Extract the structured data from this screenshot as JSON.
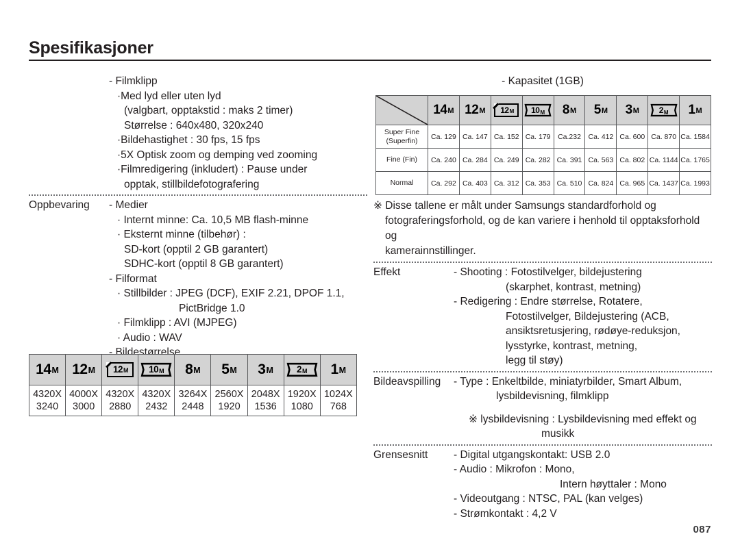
{
  "page": {
    "title": "Spesifikasjoner",
    "number": "087"
  },
  "left_column": {
    "block_movie": {
      "lines": [
        "- Filmklipp",
        "·Med lyd eller uten lyd",
        "(valgbart, opptakstid : maks 2 timer)",
        "Størrelse : 640x480, 320x240",
        "·Bildehastighet : 30 fps, 15 fps",
        "·5X Optisk zoom og demping ved zooming",
        "·Filmredigering (inkludert) : Pause under",
        "opptak, stillbildefotografering"
      ]
    },
    "block_storage": {
      "label": "Oppbevaring",
      "lines": [
        "- Medier",
        "· Internt minne: Ca. 10,5 MB flash-minne",
        "· Eksternt minne (tilbehør) :",
        "SD-kort (opptil 2 GB garantert)",
        "SDHC-kort (opptil 8 GB garantert)",
        "- Filformat",
        "· Stillbilder : JPEG (DCF), EXIF 2.21, DPOF 1.1,",
        "PictBridge 1.0",
        "· Filmklipp : AVI (MJPEG)",
        "· Audio : WAV",
        "- Bildestørrelse"
      ]
    }
  },
  "image_size_table": {
    "icons": [
      {
        "num": "14",
        "unit": "M",
        "style": "plain"
      },
      {
        "num": "12",
        "unit": "M",
        "style": "plain"
      },
      {
        "num": "12",
        "unit": "M",
        "style": "framed"
      },
      {
        "num": "10",
        "unit": "M",
        "style": "wide"
      },
      {
        "num": "8",
        "unit": "M",
        "style": "plain"
      },
      {
        "num": "5",
        "unit": "M",
        "style": "plain"
      },
      {
        "num": "3",
        "unit": "M",
        "style": "plain"
      },
      {
        "num": "2",
        "unit": "M",
        "style": "wide"
      },
      {
        "num": "1",
        "unit": "M",
        "style": "plain"
      }
    ],
    "resolutions": [
      {
        "w": "4320X",
        "h": "3240"
      },
      {
        "w": "4000X",
        "h": "3000"
      },
      {
        "w": "4320X",
        "h": "2880"
      },
      {
        "w": "4320X",
        "h": "2432"
      },
      {
        "w": "3264X",
        "h": "2448"
      },
      {
        "w": "2560X",
        "h": "1920"
      },
      {
        "w": "2048X",
        "h": "1536"
      },
      {
        "w": "1920X",
        "h": "1080"
      },
      {
        "w": "1024X",
        "h": "768"
      }
    ]
  },
  "capacity_table": {
    "title": "- Kapasitet (1GB)",
    "icons": [
      {
        "num": "14",
        "unit": "M",
        "style": "plain"
      },
      {
        "num": "12",
        "unit": "M",
        "style": "plain"
      },
      {
        "num": "12",
        "unit": "M",
        "style": "framed"
      },
      {
        "num": "10",
        "unit": "M",
        "style": "wide"
      },
      {
        "num": "8",
        "unit": "M",
        "style": "plain"
      },
      {
        "num": "5",
        "unit": "M",
        "style": "plain"
      },
      {
        "num": "3",
        "unit": "M",
        "style": "plain"
      },
      {
        "num": "2",
        "unit": "M",
        "style": "wide"
      },
      {
        "num": "1",
        "unit": "M",
        "style": "plain"
      }
    ],
    "rows": [
      {
        "label_line1": "Super Fine",
        "label_line2": "(Superfin)",
        "values": [
          "Ca. 129",
          "Ca. 147",
          "Ca. 152",
          "Ca. 179",
          "Ca.232",
          "Ca. 412",
          "Ca. 600",
          "Ca. 870",
          "Ca. 1584"
        ]
      },
      {
        "label_line1": "Fine (Fin)",
        "label_line2": "",
        "values": [
          "Ca. 240",
          "Ca. 284",
          "Ca. 249",
          "Ca. 282",
          "Ca. 391",
          "Ca. 563",
          "Ca. 802",
          "Ca. 1144",
          "Ca. 1765"
        ]
      },
      {
        "label_line1": "Normal",
        "label_line2": "",
        "values": [
          "Ca. 292",
          "Ca. 403",
          "Ca. 312",
          "Ca. 353",
          "Ca. 510",
          "Ca. 824",
          "Ca. 965",
          "Ca. 1437",
          "Ca. 1993"
        ]
      }
    ]
  },
  "right_column": {
    "note": {
      "line1": "※ Disse tallene er målt under Samsungs standardforhold og",
      "line2": "fotograferingsforhold, og de kan variere i henhold til opptaksforhold og",
      "line3": "kamerainnstillinger."
    },
    "block_effect": {
      "label": "Effekt",
      "lines": [
        "- Shooting : Fotostilvelger, bildejustering",
        "(skarphet, kontrast, metning)",
        "- Redigering : Endre størrelse, Rotatere,",
        "Fotostilvelger, Bildejustering (ACB,",
        "ansiktsretusjering, rødøye-reduksjon,",
        "lysstyrke, kontrast, metning,",
        "legg til støy)"
      ]
    },
    "block_playback": {
      "label": "Bildeavspilling",
      "lines": [
        "- Type : Enkeltbilde, miniatyrbilder, Smart Album,",
        "lysbildevisning, filmklipp",
        "※ lysbildevisning : Lysbildevisning med effekt og",
        "musikk"
      ]
    },
    "block_interface": {
      "label": "Grensesnitt",
      "lines": [
        "- Digital utgangskontakt: USB 2.0",
        "- Audio : Mikrofon : Mono,",
        "Intern høyttaler : Mono",
        "- Videoutgang : NTSC, PAL (kan velges)",
        "- Strømkontakt : 4,2 V"
      ]
    }
  }
}
